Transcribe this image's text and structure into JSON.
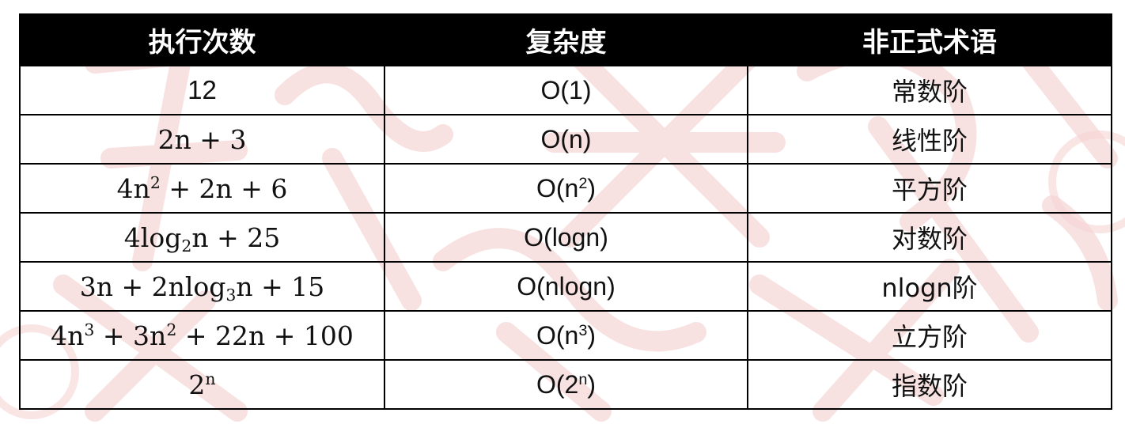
{
  "table": {
    "headers": [
      "执行次数",
      "复杂度",
      "非正式术语"
    ],
    "rows": [
      {
        "count": "12",
        "count_parts": [
          {
            "t": "12"
          }
        ],
        "complexity": "O(1)",
        "complexity_parts": [
          {
            "t": "O(1)"
          }
        ],
        "term": "常数阶"
      },
      {
        "count": "2n + 3",
        "count_parts": [
          {
            "t": "2n + 3"
          }
        ],
        "complexity": "O(n)",
        "complexity_parts": [
          {
            "t": "O(n)"
          }
        ],
        "term": "线性阶"
      },
      {
        "count": "4n2 + 2n + 6",
        "count_parts": [
          {
            "t": "4n"
          },
          {
            "sup": "2"
          },
          {
            "t": " + 2n + 6"
          }
        ],
        "complexity": "O(n2)",
        "complexity_parts": [
          {
            "t": "O(n"
          },
          {
            "sup": "2"
          },
          {
            "t": ")"
          }
        ],
        "term": "平方阶"
      },
      {
        "count": "4log2n + 25",
        "count_parts": [
          {
            "t": "4log"
          },
          {
            "sub": "2"
          },
          {
            "t": "n + 25"
          }
        ],
        "complexity": "O(logn)",
        "complexity_parts": [
          {
            "t": "O(logn)"
          }
        ],
        "term": "对数阶"
      },
      {
        "count": "3n + 2nlog3n + 15",
        "count_parts": [
          {
            "t": "3n + 2nlog"
          },
          {
            "sub": "3"
          },
          {
            "t": "n + 15"
          }
        ],
        "complexity": "O(nlogn)",
        "complexity_parts": [
          {
            "t": "O(nlogn)"
          }
        ],
        "term": "nlogn阶"
      },
      {
        "count": "4n3 + 3n2 + 22n + 100",
        "count_parts": [
          {
            "t": "4n"
          },
          {
            "sup": "3"
          },
          {
            "t": " + 3n"
          },
          {
            "sup": "2"
          },
          {
            "t": " + 22n + 100"
          }
        ],
        "complexity": "O(n3)",
        "complexity_parts": [
          {
            "t": "O(n"
          },
          {
            "sup": "3"
          },
          {
            "t": ")"
          }
        ],
        "term": "立方阶"
      },
      {
        "count": "2n",
        "count_parts": [
          {
            "t": "2"
          },
          {
            "sup": "n"
          }
        ],
        "complexity": "O(2n)",
        "complexity_parts": [
          {
            "t": "O(2"
          },
          {
            "sup": "n"
          },
          {
            "t": ")"
          }
        ],
        "term": "指数阶"
      }
    ]
  },
  "colors": {
    "header_bg": "#000000",
    "header_text": "#ffffff",
    "border": "#000000",
    "watermark": "#e8a0a0"
  }
}
